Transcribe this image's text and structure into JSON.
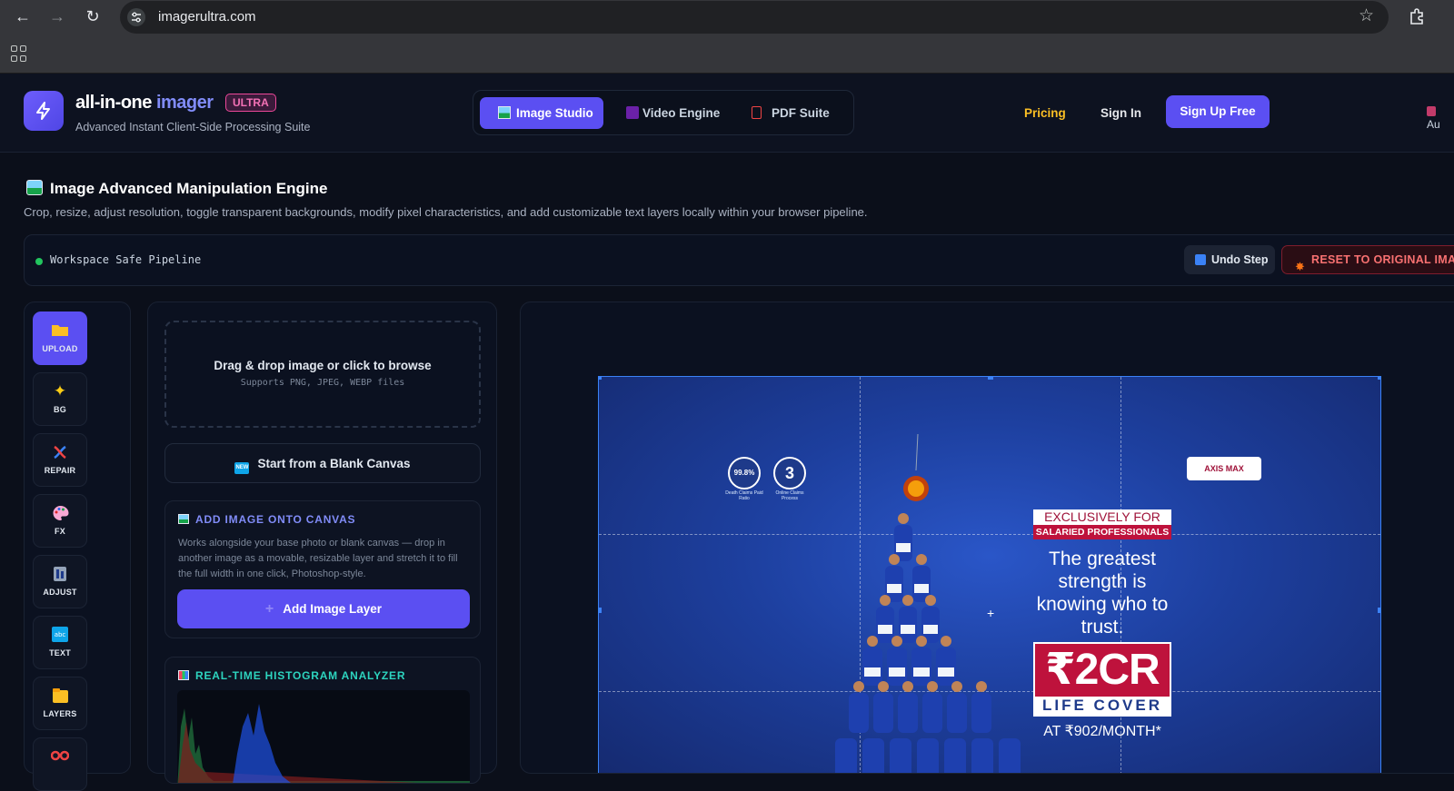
{
  "browser": {
    "url": "imagerultra.com"
  },
  "header": {
    "brand_main": "all-in-one",
    "brand_accent": "imager",
    "badge": "ULTRA",
    "tagline": "Advanced Instant Client-Side Processing Suite",
    "tabs": [
      {
        "label": "Image Studio",
        "active": true,
        "icon": "image-icon"
      },
      {
        "label": "Video Engine",
        "active": false,
        "icon": "clapper-icon"
      },
      {
        "label": "PDF Suite",
        "active": false,
        "icon": "pdf-icon"
      }
    ],
    "pricing": "Pricing",
    "sign_in": "Sign In",
    "sign_up": "Sign Up Free",
    "cut_label": "Au"
  },
  "engine": {
    "title": "Image Advanced Manipulation Engine",
    "description": "Crop, resize, adjust resolution, toggle transparent backgrounds, modify pixel characteristics, and add customizable text layers locally within your browser pipeline."
  },
  "status": {
    "text": "Workspace Safe Pipeline",
    "undo": "Undo Step",
    "reset": "RESET TO ORIGINAL IMA"
  },
  "rail": [
    {
      "label": "UPLOAD",
      "icon": "folder-icon",
      "active": true
    },
    {
      "label": "BG",
      "icon": "sparkles-icon",
      "active": false
    },
    {
      "label": "REPAIR",
      "icon": "dna-icon",
      "active": false
    },
    {
      "label": "FX",
      "icon": "palette-icon",
      "active": false
    },
    {
      "label": "ADJUST",
      "icon": "adjust-icon",
      "active": false
    },
    {
      "label": "TEXT",
      "icon": "text-icon",
      "active": false
    },
    {
      "label": "LAYERS",
      "icon": "layers-icon",
      "active": false
    }
  ],
  "tools": {
    "dropzone_title": "Drag & drop image or click to browse",
    "dropzone_sub": "Supports PNG, JPEG, WEBP files",
    "blank_canvas": "Start from a Blank Canvas",
    "blank_badge": "NEW",
    "add_title": "ADD IMAGE ONTO CANVAS",
    "add_desc": "Works alongside your base photo or blank canvas — drop in another image as a movable, resizable layer and stretch it to fill the full width in one click, Photoshop-style.",
    "add_button": "Add Image Layer",
    "histogram_title": "REAL-TIME HISTOGRAM ANALYZER"
  },
  "artwork": {
    "seal1_value": "99.8%",
    "seal1_caption": "Death Claims Paid Ratio",
    "seal2_value": "3",
    "seal2_caption": "Online Claims Process",
    "logo_text": "AXIS MAX",
    "ribbon_top": "EXCLUSIVELY FOR",
    "ribbon_bottom": "SALARIED PROFESSIONALS",
    "tagline": "The greatest strength is knowing who to trust.",
    "cover_amount": "₹2CR",
    "cover_label": "LIFE COVER",
    "cover_price": "AT ₹902/MONTH*"
  },
  "colors": {
    "accent": "#5b4ff2",
    "pricing": "#fbbf24",
    "status_ok": "#22c55e",
    "danger": "#f87171"
  }
}
